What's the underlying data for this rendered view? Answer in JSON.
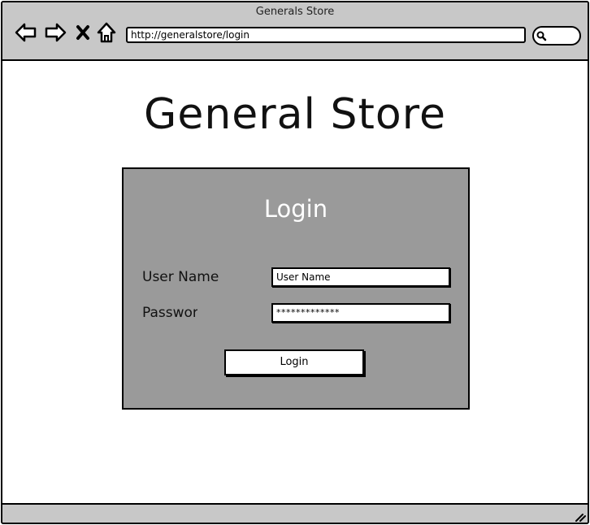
{
  "window": {
    "title": "Generals Store"
  },
  "toolbar": {
    "back_icon": "back-arrow-icon",
    "forward_icon": "forward-arrow-icon",
    "stop_icon": "close-icon",
    "home_icon": "home-icon",
    "search_icon": "search-icon"
  },
  "address_bar": {
    "url": "http://generalstore/login"
  },
  "page": {
    "title": "General Store"
  },
  "login_form": {
    "heading": "Login",
    "username_label": "User Name",
    "username_value": "User Name",
    "password_label": "Password",
    "password_value": "*************",
    "submit_label": "Login"
  },
  "colors": {
    "chrome": "#c8c8c8",
    "panel": "#9a9a9a",
    "panel_heading": "#ffffff"
  }
}
